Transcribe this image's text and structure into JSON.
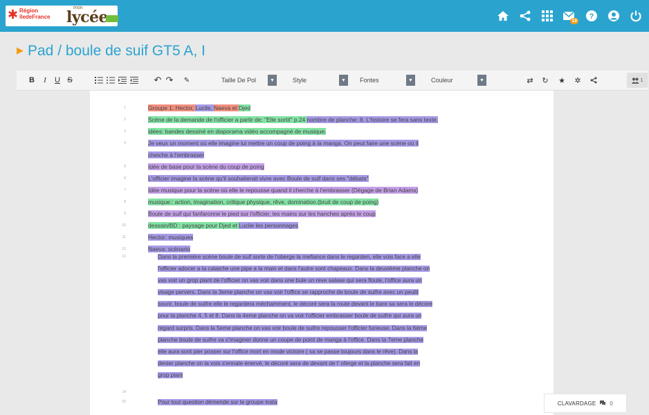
{
  "header": {
    "region_line1": "Région",
    "region_line2": "îledeFrance",
    "lycee_small": "mon",
    "lycee_big": "lycée",
    "lycee_badge": "",
    "notif_count": "19"
  },
  "page": {
    "title": "Pad / boule de suif GT5 A, I"
  },
  "toolbar": {
    "bold": "B",
    "italic": "I",
    "underline": "U",
    "strike": "S",
    "size_label": "Taille De Pol",
    "style_label": "Style",
    "fonts_label": "Fontes",
    "color_label": "Couleur",
    "users_count": "1"
  },
  "doc": {
    "lines": [
      {
        "num": "1",
        "segs": [
          {
            "t": "Groupe 1: Hector, ",
            "c": "o"
          },
          {
            "t": "Lucile, ",
            "c": "p"
          },
          {
            "t": "Naeva et ",
            "c": "o"
          },
          {
            "t": "Djed",
            "c": "g"
          }
        ]
      },
      {
        "num": "2",
        "segs": [
          {
            "t": "Scène de la demande de l'officier a partir de: \"Elle sortit\" p.24 ",
            "c": "g"
          },
          {
            "t": "nombre de planche: 8. L'histoire se fera sans texte.",
            "c": "p"
          }
        ]
      },
      {
        "num": "3",
        "segs": [
          {
            "t": "idées: bandes dessiné en diaporama vidéo accompagné de musique.",
            "c": "g"
          }
        ]
      },
      {
        "num": "4",
        "segs": [
          {
            "t": "Je veux un moment où elle imagine lui mettre un coup de poing à la manga.  On peut faire une scène où il",
            "c": "p"
          }
        ]
      },
      {
        "num": "",
        "segs": [
          {
            "t": "cheiche à l'embrasser",
            "c": "p"
          }
        ]
      },
      {
        "num": "5",
        "segs": [
          {
            "t": "Idée de base pour la scène du coup de poing",
            "c": "v"
          }
        ]
      },
      {
        "num": "6",
        "segs": [
          {
            "t": "L'officier imagine la scène qu'il souhaiterait vivre avec Boule de suif dans ses \"débats\"",
            "c": "p"
          }
        ]
      },
      {
        "num": "7",
        "segs": [
          {
            "t": "Idée musique pour la scène où elle le repousse quand il cherche à l'embrasser (Dégage de Brian Adams)",
            "c": "v"
          }
        ]
      },
      {
        "num": "8",
        "segs": [
          {
            "t": "musique:: action, imagination, critique physique, rêve, domination.(bruit de coup de poing)",
            "c": "g"
          }
        ]
      },
      {
        "num": "9",
        "segs": [
          {
            "t": "Boule de suif qui fanfaronne le pied sur l'officier, les mains sur les hanches après le coup",
            "c": "v"
          }
        ]
      },
      {
        "num": "10",
        "segs": [
          {
            "t": "desssin/BD : paysage pour Djed et ",
            "c": "g"
          },
          {
            "t": "Lucile les personnages",
            "c": "p"
          }
        ]
      },
      {
        "num": "11",
        "segs": [
          {
            "t": "Hector: musiques",
            "c": "p"
          }
        ]
      },
      {
        "num": "12",
        "segs": [
          {
            "t": "Naeva: scénario",
            "c": "p"
          }
        ]
      }
    ],
    "para_num": "13",
    "para_lines": [
      "Dans la première scène boule de suif sorte de l'oberge la mefiance dans le regarden, elle vois face a elle",
      "l'officier adocer a la calaiche une pipe a la main et dans l'autre sont chapeaux. Dans la deuxième planche on",
      "vas voir un grop plant de l'officier on vas voir dans une bule un reve salase qui sera floute, l'office aura un",
      "visage pervers. Dans la 3eme planche on vas voir l'office se rapproche de boule de suifre avec un peutit",
      "sourir, boule de suifre elle le regardera méchamment, le décoré sera la route devant le bare sa sera le décore",
      "pour la planche 4, 5 et 8. Dans la 4eme planche on va voir l'officier embrasser boule de suifre qui aura un",
      "regard surpris. Dans la 5eme planche on vas voir boule de suifre repousser l'officier furieuse. Dans la 6ème",
      "planche boule de suifre va s'imaginer donne un coupe de point de manga à l'office. Dans la 7eme planche",
      "elle aura sont pier posser sur l'office mort en mode victoire ( sa se passe toujours dans le rêve). Dans la",
      "denier planche on la vois s'ennale énervé, le décoré sera de devant de l' oferge et la planche sera fait en",
      "grop plant"
    ],
    "num_14": "14",
    "num_15": "15",
    "last_line": "Pour tout question démende sur le groupe insta"
  },
  "chat": {
    "label": "CLAVARDAGE",
    "count": "0"
  }
}
